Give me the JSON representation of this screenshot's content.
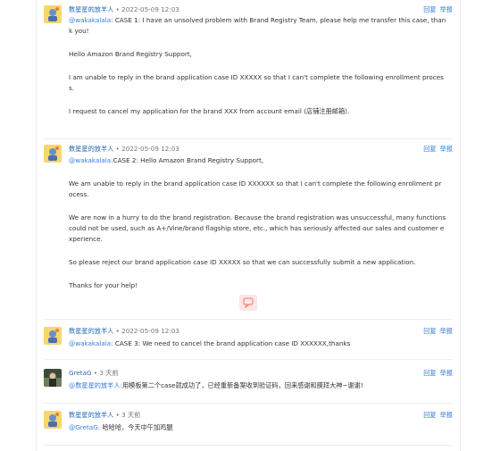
{
  "comments": [
    {
      "author": "数星星的放羊人",
      "meta": " • 2022-05-09 12:03",
      "reply": "回复",
      "report": "举报",
      "mention": "@wakakalala:",
      "lines": [
        " CASE 1: I have an unsolved problem with Brand Registry Team, please help me transfer this case, than",
        "k you!"
      ],
      "paras": [
        [
          "Hello Amazon Brand Registry Support,"
        ],
        [
          "I am unable to reply in the brand application case ID XXXXX so that I can't complete the following enrollment proces",
          "s."
        ],
        [
          "I request to cancel my application for the brand XXX from account email (店铺注册邮箱)."
        ]
      ]
    },
    {
      "author": "数星星的放羊人",
      "meta": " • 2022-05-09 12:03",
      "reply": "回复",
      "report": "举报",
      "mention": "@wakakalala:",
      "lines": [
        "CASE 2: Hello Amazon Brand Registry Support,"
      ],
      "paras": [
        [
          "We am unable to reply in the brand application case ID XXXXXX so that I can't complete the following enrollment pr",
          "ocess."
        ],
        [
          "We are now in a hurry to do the brand registration. Because the brand registration was unsuccessful, many functions",
          "could not be used, such as A+/Vine/brand flagship store, etc., which has seriously affected our sales and customer e",
          "xperience."
        ],
        [
          "So please reject our brand application case ID XXXXX so that we can successfully submit a new application."
        ],
        [
          "Thanks for your help!"
        ]
      ]
    },
    {
      "author": "数星星的放羊人",
      "meta": " • 2022-05-09 12:03",
      "reply": "回复",
      "report": "举报",
      "mention": "@wakakalala:",
      "lines": [
        " CASE 3:  We need to cancel the brand application case ID XXXXXX,thanks"
      ]
    },
    {
      "author": "GretaG",
      "meta": " • 3 天前",
      "reply": "回复",
      "report": "举报",
      "mention": "@数星星的放羊人:",
      "lines": [
        "用模板第二个case就成功了，已经重新备案收到验证码，回来感谢和膜拜大神~谢谢!"
      ]
    },
    {
      "author": "数星星的放羊人",
      "meta": " • 3 天前",
      "reply": "回复",
      "report": "举报",
      "mention": "@GretaG:",
      "lines": [
        " 哈哈哈，今天中午加鸡腿"
      ]
    }
  ],
  "colors": {
    "link": "#3b7dd8",
    "author": "#2a6ab8",
    "text": "#333333",
    "meta": "#777777"
  },
  "icons": {
    "avatar_star": "avatar-icon",
    "avatar_greta": "avatar-icon",
    "float_badge": "chat-icon"
  }
}
